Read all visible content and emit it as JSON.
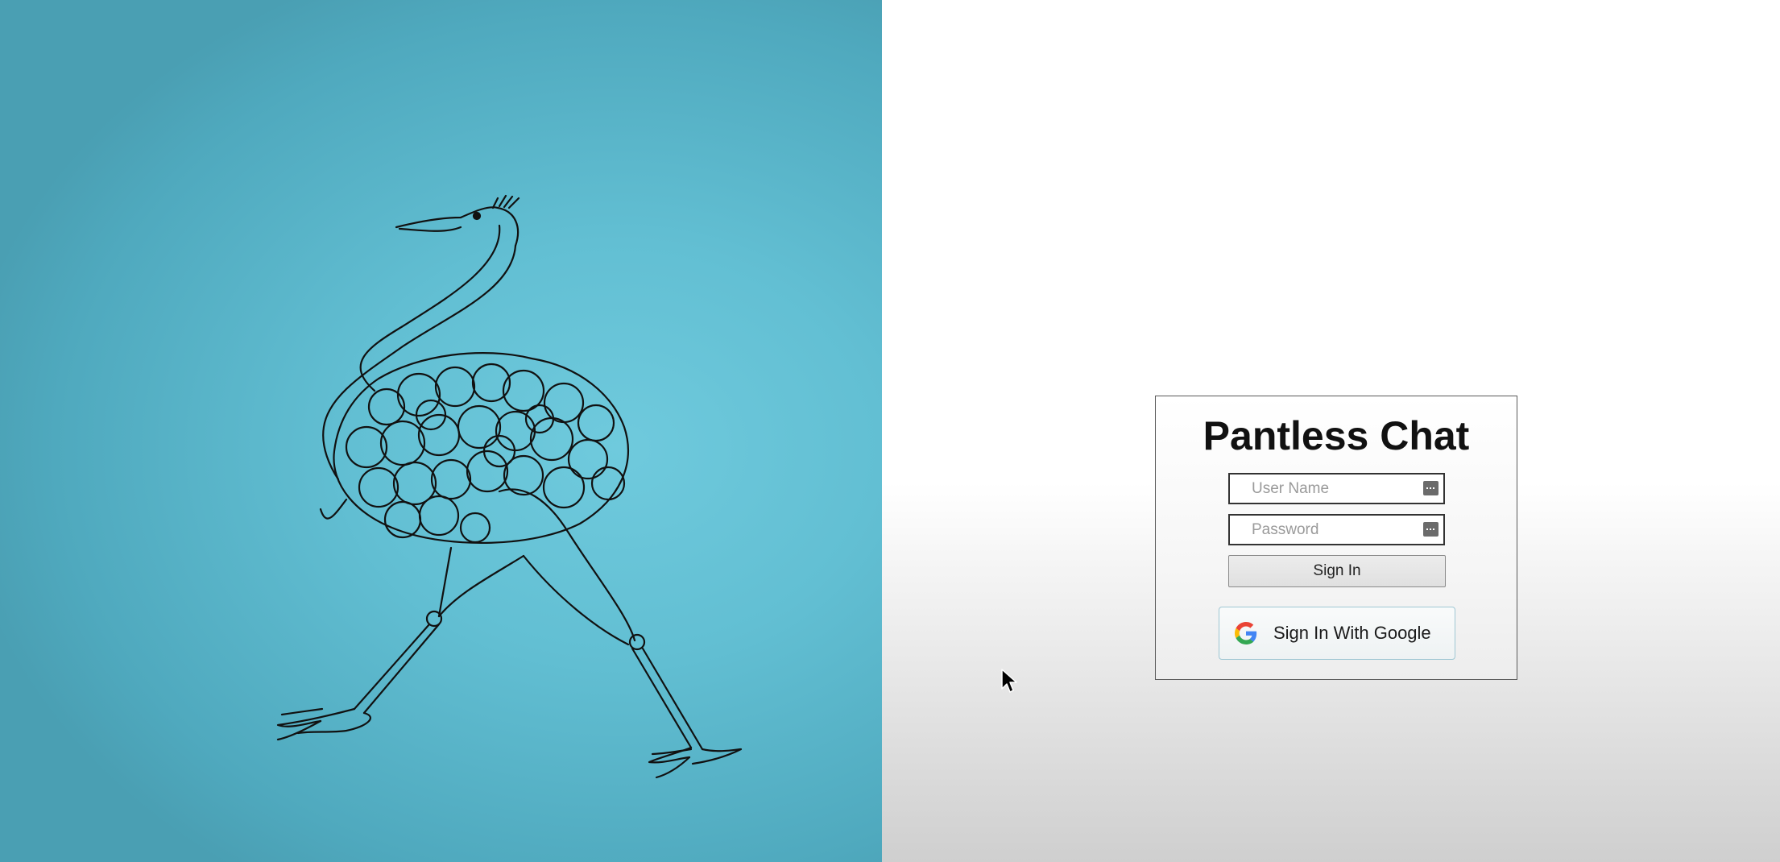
{
  "login": {
    "title": "Pantless Chat",
    "username_placeholder": "User Name",
    "password_placeholder": "Password",
    "signin_label": "Sign In",
    "google_label": "Sign In With Google"
  },
  "illustration": {
    "subject": "ostrich-line-drawing"
  },
  "colors": {
    "left_background": "#5fbcd0",
    "right_background": "#ffffff",
    "google_blue": "#4285F4",
    "google_red": "#EA4335",
    "google_yellow": "#FBBC05",
    "google_green": "#34A853"
  }
}
